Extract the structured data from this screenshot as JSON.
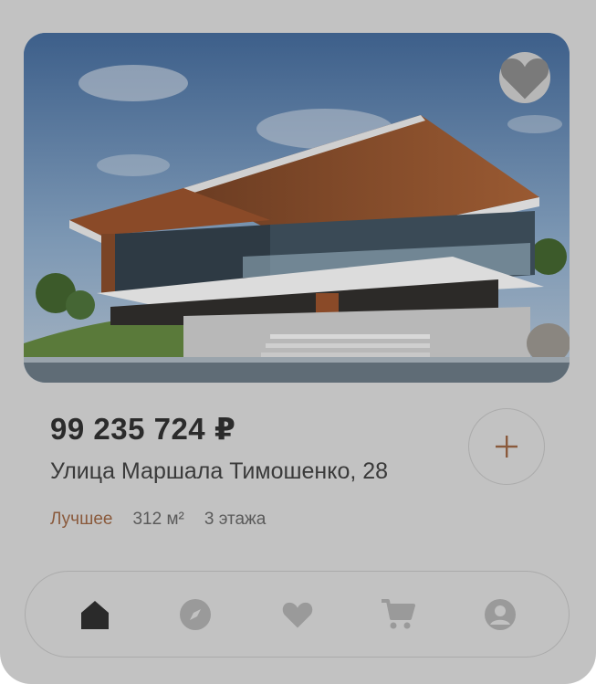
{
  "listing": {
    "price": "99 235 724 ₽",
    "address": "Улица Маршала Тимошенко, 28",
    "tags": [
      "Лучшее",
      "312 м²",
      "3 этажа"
    ]
  },
  "icons": {
    "favorite": "heart-icon",
    "add": "plus-icon"
  },
  "nav": {
    "items": [
      "home-icon",
      "compass-icon",
      "heart-icon",
      "cart-icon",
      "profile-icon"
    ],
    "active_index": 0
  },
  "colors": {
    "background": "#c2c2c2",
    "accent": "#8a5a3c",
    "text": "#2b2b2b"
  }
}
